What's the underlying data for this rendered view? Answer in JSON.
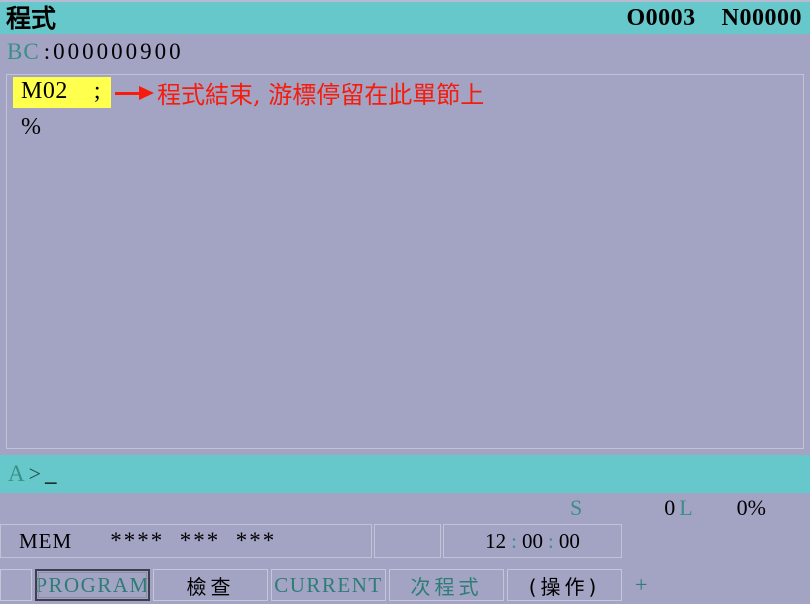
{
  "header": {
    "title": "程式",
    "program_number": "O0003",
    "sequence_number": "N00000"
  },
  "bc_line": {
    "label": "BC",
    "separator": ":",
    "value": "000000900"
  },
  "program": {
    "lines": [
      {
        "code": "M02    ;",
        "highlighted": true
      },
      {
        "code": "%",
        "highlighted": false
      }
    ],
    "annotation": {
      "icon": "arrow-right-icon",
      "text": "程式結束, 游標停留在此單節上",
      "color": "#f71b0c"
    }
  },
  "input_line": {
    "prefix": "A",
    "prompt": ">",
    "cursor": "_",
    "value": ""
  },
  "spindle_status": {
    "spindle_label": "S",
    "spindle_value": "0",
    "tool_label": "L",
    "override_value": "0%"
  },
  "status_bar": {
    "mode": "MEM",
    "alarm_flags": "****  ***  ***",
    "time": {
      "hours": "12",
      "colon1": ":",
      "minutes": "00",
      "colon2": ":",
      "seconds": "00"
    }
  },
  "soft_keys": [
    {
      "label": "PROGRAM",
      "selected": true,
      "style": "teal",
      "cjk": false
    },
    {
      "label": "檢查",
      "selected": false,
      "style": "black",
      "cjk": true
    },
    {
      "label": "CURRENT",
      "selected": false,
      "style": "teal",
      "cjk": false
    },
    {
      "label": "次程式",
      "selected": false,
      "style": "teal",
      "cjk": true
    },
    {
      "label": "(操作)",
      "selected": false,
      "style": "black",
      "cjk": true
    }
  ],
  "soft_key_more": "+",
  "colors": {
    "background": "#a3a3c4",
    "accent_teal": "#66c8ca",
    "label_teal": "#3a8f86",
    "highlight_yellow": "#ffff4d",
    "annotation_red": "#f71b0c",
    "border": "#c3c3d8"
  }
}
